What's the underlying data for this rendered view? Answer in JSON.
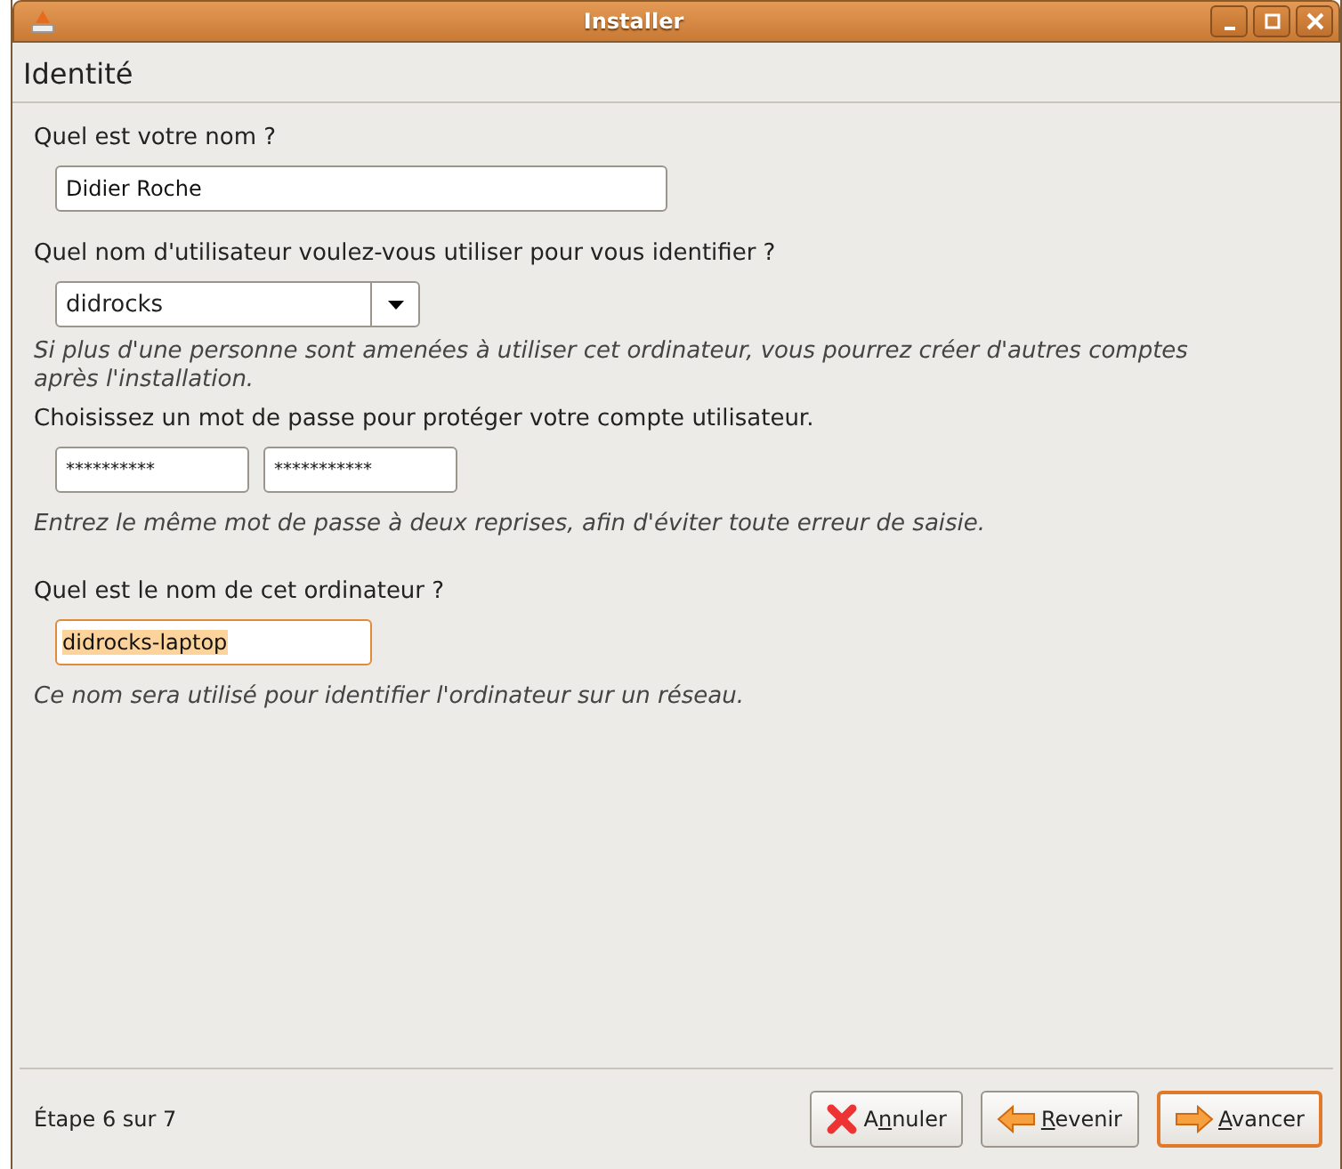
{
  "window": {
    "title": "Installer"
  },
  "heading": "Identité",
  "name_section": {
    "label": "Quel est votre nom ?",
    "value": "Didier Roche"
  },
  "username_section": {
    "label": "Quel nom d'utilisateur voulez-vous utiliser pour vous identifier ?",
    "value": "didrocks",
    "hint": "Si plus d'une personne sont amenées à utiliser cet ordinateur, vous pourrez créer d'autres comptes après l'installation."
  },
  "password_section": {
    "label": "Choisissez un mot de passe pour protéger votre compte utilisateur.",
    "fields": [
      {
        "value": "**********"
      },
      {
        "value": "***********"
      }
    ],
    "hint": "Entrez le même mot de passe à deux reprises, afin d'éviter toute erreur de saisie."
  },
  "hostname_section": {
    "label": "Quel est le nom de cet ordinateur ?",
    "value": "didrocks-laptop",
    "focused": true,
    "hint": "Ce nom sera utilisé pour identifier l'ordinateur sur un réseau."
  },
  "status": "Étape 6 sur 7",
  "buttons": [
    {
      "kind": "cancel",
      "pre": "A",
      "key": "n",
      "post": "nuler",
      "default": false
    },
    {
      "kind": "back",
      "key": "R",
      "post": "evenir",
      "default": false
    },
    {
      "kind": "forward",
      "key": "A",
      "post": "vancer",
      "default": true
    }
  ]
}
